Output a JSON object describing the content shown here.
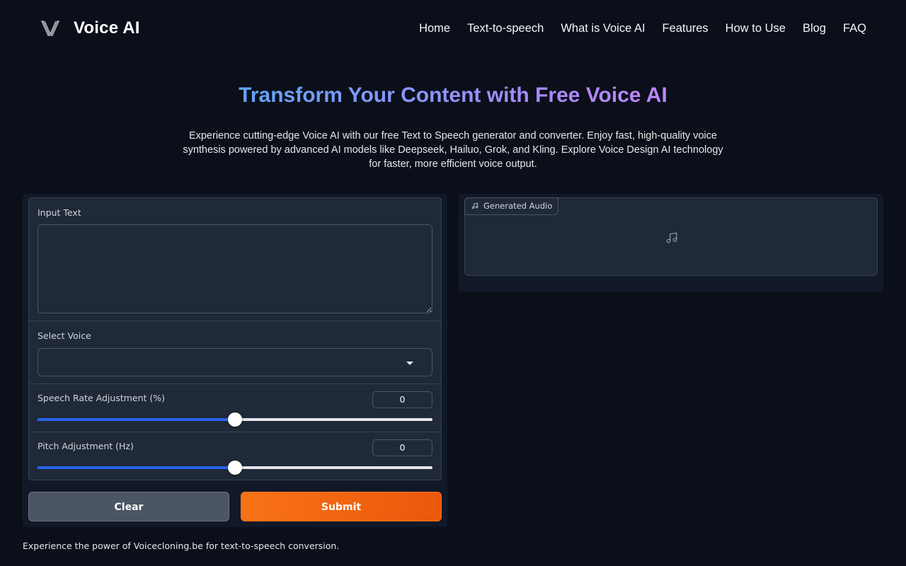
{
  "header": {
    "brand_name": "Voice AI",
    "logo_icon": "v-logo-icon",
    "nav": [
      {
        "label": "Home"
      },
      {
        "label": "Text-to-speech"
      },
      {
        "label": "What is Voice AI"
      },
      {
        "label": "Features"
      },
      {
        "label": "How to Use"
      },
      {
        "label": "Blog"
      },
      {
        "label": "FAQ"
      }
    ]
  },
  "hero": {
    "title": "Transform Your Content with Free Voice AI",
    "description": "Experience cutting-edge Voice AI with our free Text to Speech generator and converter. Enjoy fast, high-quality voice synthesis powered by advanced AI models like Deepseek, Hailuo, Grok, and Kling. Explore Voice Design AI technology for faster, more efficient voice output."
  },
  "form": {
    "input_text_label": "Input Text",
    "input_text_value": "",
    "select_voice_label": "Select Voice",
    "select_voice_value": "",
    "speech_rate": {
      "label": "Speech Rate Adjustment (%)",
      "value": "0",
      "level": 0.5
    },
    "pitch": {
      "label": "Pitch Adjustment (Hz)",
      "value": "0",
      "level": 0.5
    },
    "clear_label": "Clear",
    "submit_label": "Submit"
  },
  "output": {
    "audio_label": "Generated Audio",
    "icon": "music-note-icon"
  },
  "footer": {
    "text": "Experience the power of Voicecloning.be for text-to-speech conversion."
  },
  "colors": {
    "background": "#0b0f19",
    "panel": "#1f2937",
    "accent_blue": "#2563eb",
    "submit_orange": "#f97316",
    "clear_gray": "#4b5563"
  }
}
